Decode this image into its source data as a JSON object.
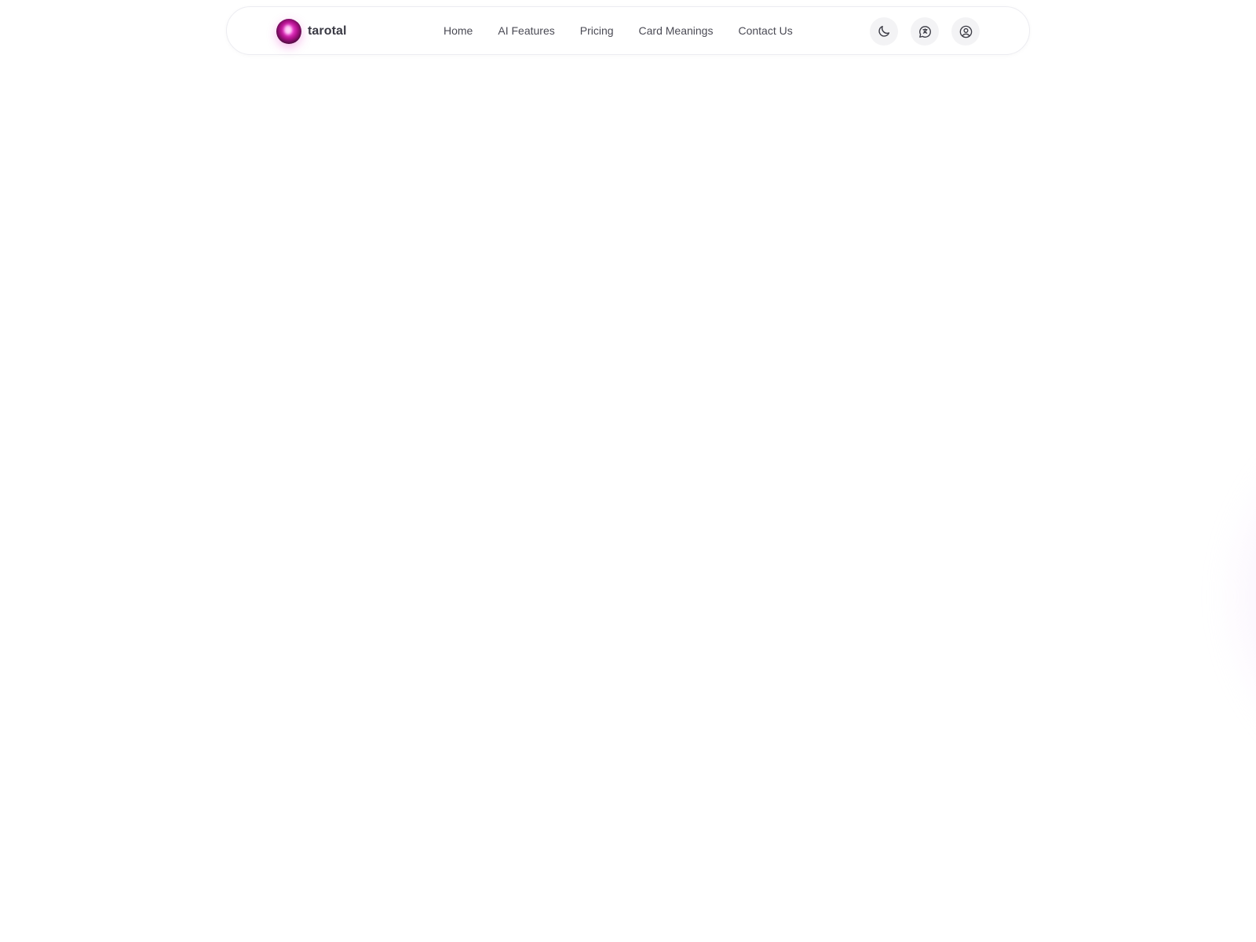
{
  "brand": {
    "name": "tarotal"
  },
  "nav": {
    "links": [
      {
        "label": "Home"
      },
      {
        "label": "AI Features"
      },
      {
        "label": "Pricing"
      },
      {
        "label": "Card Meanings"
      },
      {
        "label": "Contact Us"
      }
    ]
  },
  "actions": {
    "icons": [
      "moon-icon",
      "translate-chat-icon",
      "user-circle-icon"
    ]
  },
  "colors": {
    "accent": "#e83ac8",
    "glow": "#d9a0f5",
    "text": "#4b4b55"
  }
}
